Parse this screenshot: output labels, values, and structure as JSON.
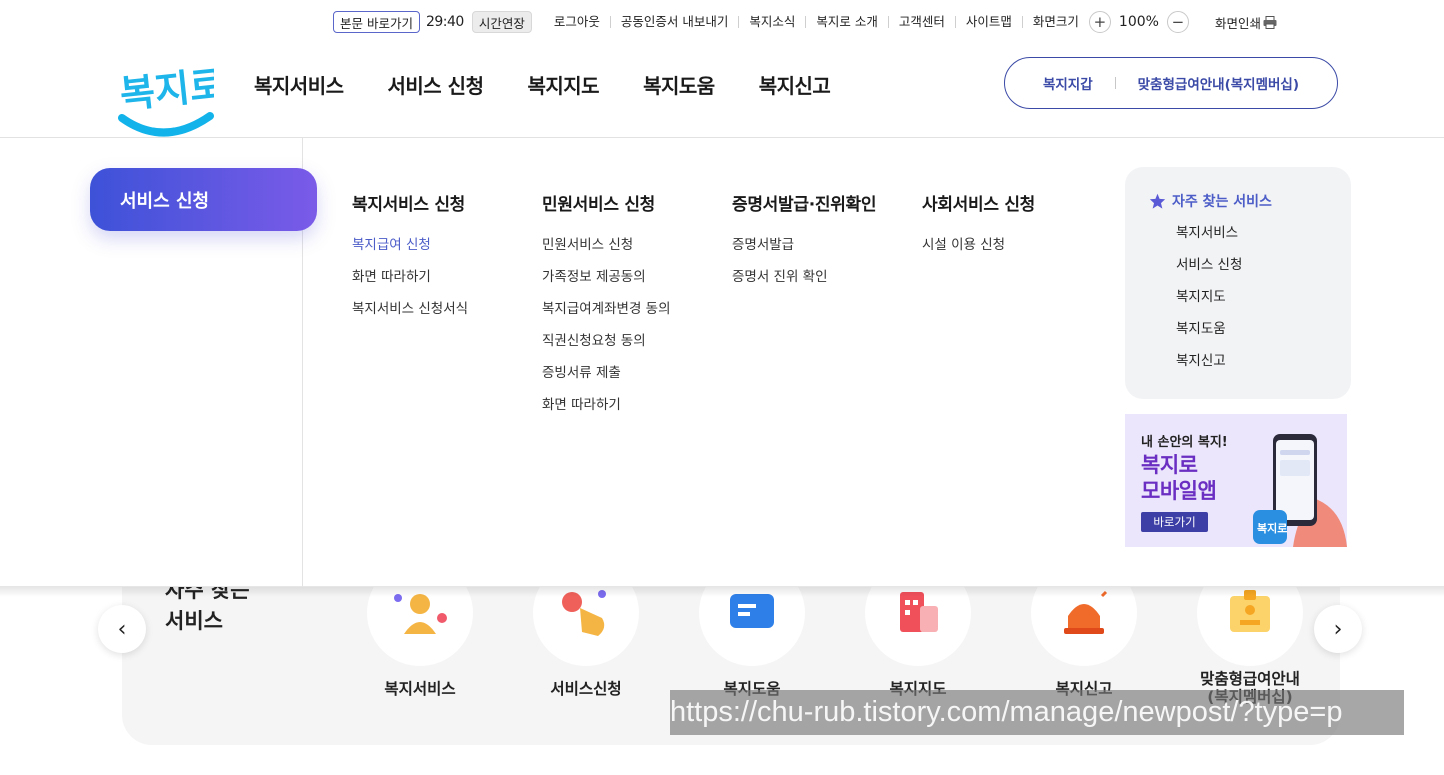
{
  "utility": {
    "skip_label": "본문 바로가기",
    "timer": "29:40",
    "extend_label": "시간연장",
    "links": [
      "로그아웃",
      "공동인증서 내보내기",
      "복지소식",
      "복지로 소개",
      "고객센터",
      "사이트맵",
      "화면크기"
    ],
    "zoom_value": "100%",
    "print_label": "화면인쇄"
  },
  "header": {
    "logo_text": "복지로",
    "gnb": [
      "복지서비스",
      "서비스 신청",
      "복지지도",
      "복지도움",
      "복지신고"
    ],
    "quick": {
      "left": "복지지갑",
      "right": "맞춤형급여안내(복지멤버십)"
    }
  },
  "mega": {
    "section_title": "서비스 신청",
    "columns": [
      {
        "title": "복지서비스 신청",
        "items": [
          "복지급여 신청",
          "화면 따라하기",
          "복지서비스 신청서식"
        ],
        "active": 0
      },
      {
        "title": "민원서비스 신청",
        "items": [
          "민원서비스 신청",
          "가족정보 제공동의",
          "복지급여계좌변경 동의",
          "직권신청요청 동의",
          "증빙서류 제출",
          "화면 따라하기"
        ],
        "active": -1
      },
      {
        "title": "증명서발급·진위확인",
        "items": [
          "증명서발급",
          "증명서 진위 확인"
        ],
        "active": -1
      },
      {
        "title": "사회서비스 신청",
        "items": [
          "시설 이용 신청"
        ],
        "active": -1
      }
    ],
    "favorites": {
      "title": "자주 찾는 서비스",
      "items": [
        "복지서비스",
        "서비스 신청",
        "복지지도",
        "복지도움",
        "복지신고"
      ]
    },
    "banner": {
      "small": "내 손안의 복지!",
      "big_line1": "복지로",
      "big_line2": "모바일앱",
      "button": "바로가기"
    }
  },
  "below": {
    "heading_line1": "자주 찾는",
    "heading_line2": "서비스",
    "services": [
      {
        "label": "복지서비스",
        "icon": "person-icon"
      },
      {
        "label": "서비스신청",
        "icon": "hand-pointer-icon"
      },
      {
        "label": "복지도움",
        "icon": "chat-bubble-icon"
      },
      {
        "label": "복지지도",
        "icon": "map-icon"
      },
      {
        "label": "복지신고",
        "icon": "siren-icon"
      },
      {
        "label": "맞춤형급여안내\n(복지멤버십)",
        "icon": "id-card-icon"
      }
    ]
  },
  "overlay_url": "https://chu-rub.tistory.com/manage/newpost/?type=p",
  "colors": {
    "accent": "#4c5dc8",
    "brand_purple": "#6a2fc2",
    "logo_blue": "#1eb5ea"
  }
}
